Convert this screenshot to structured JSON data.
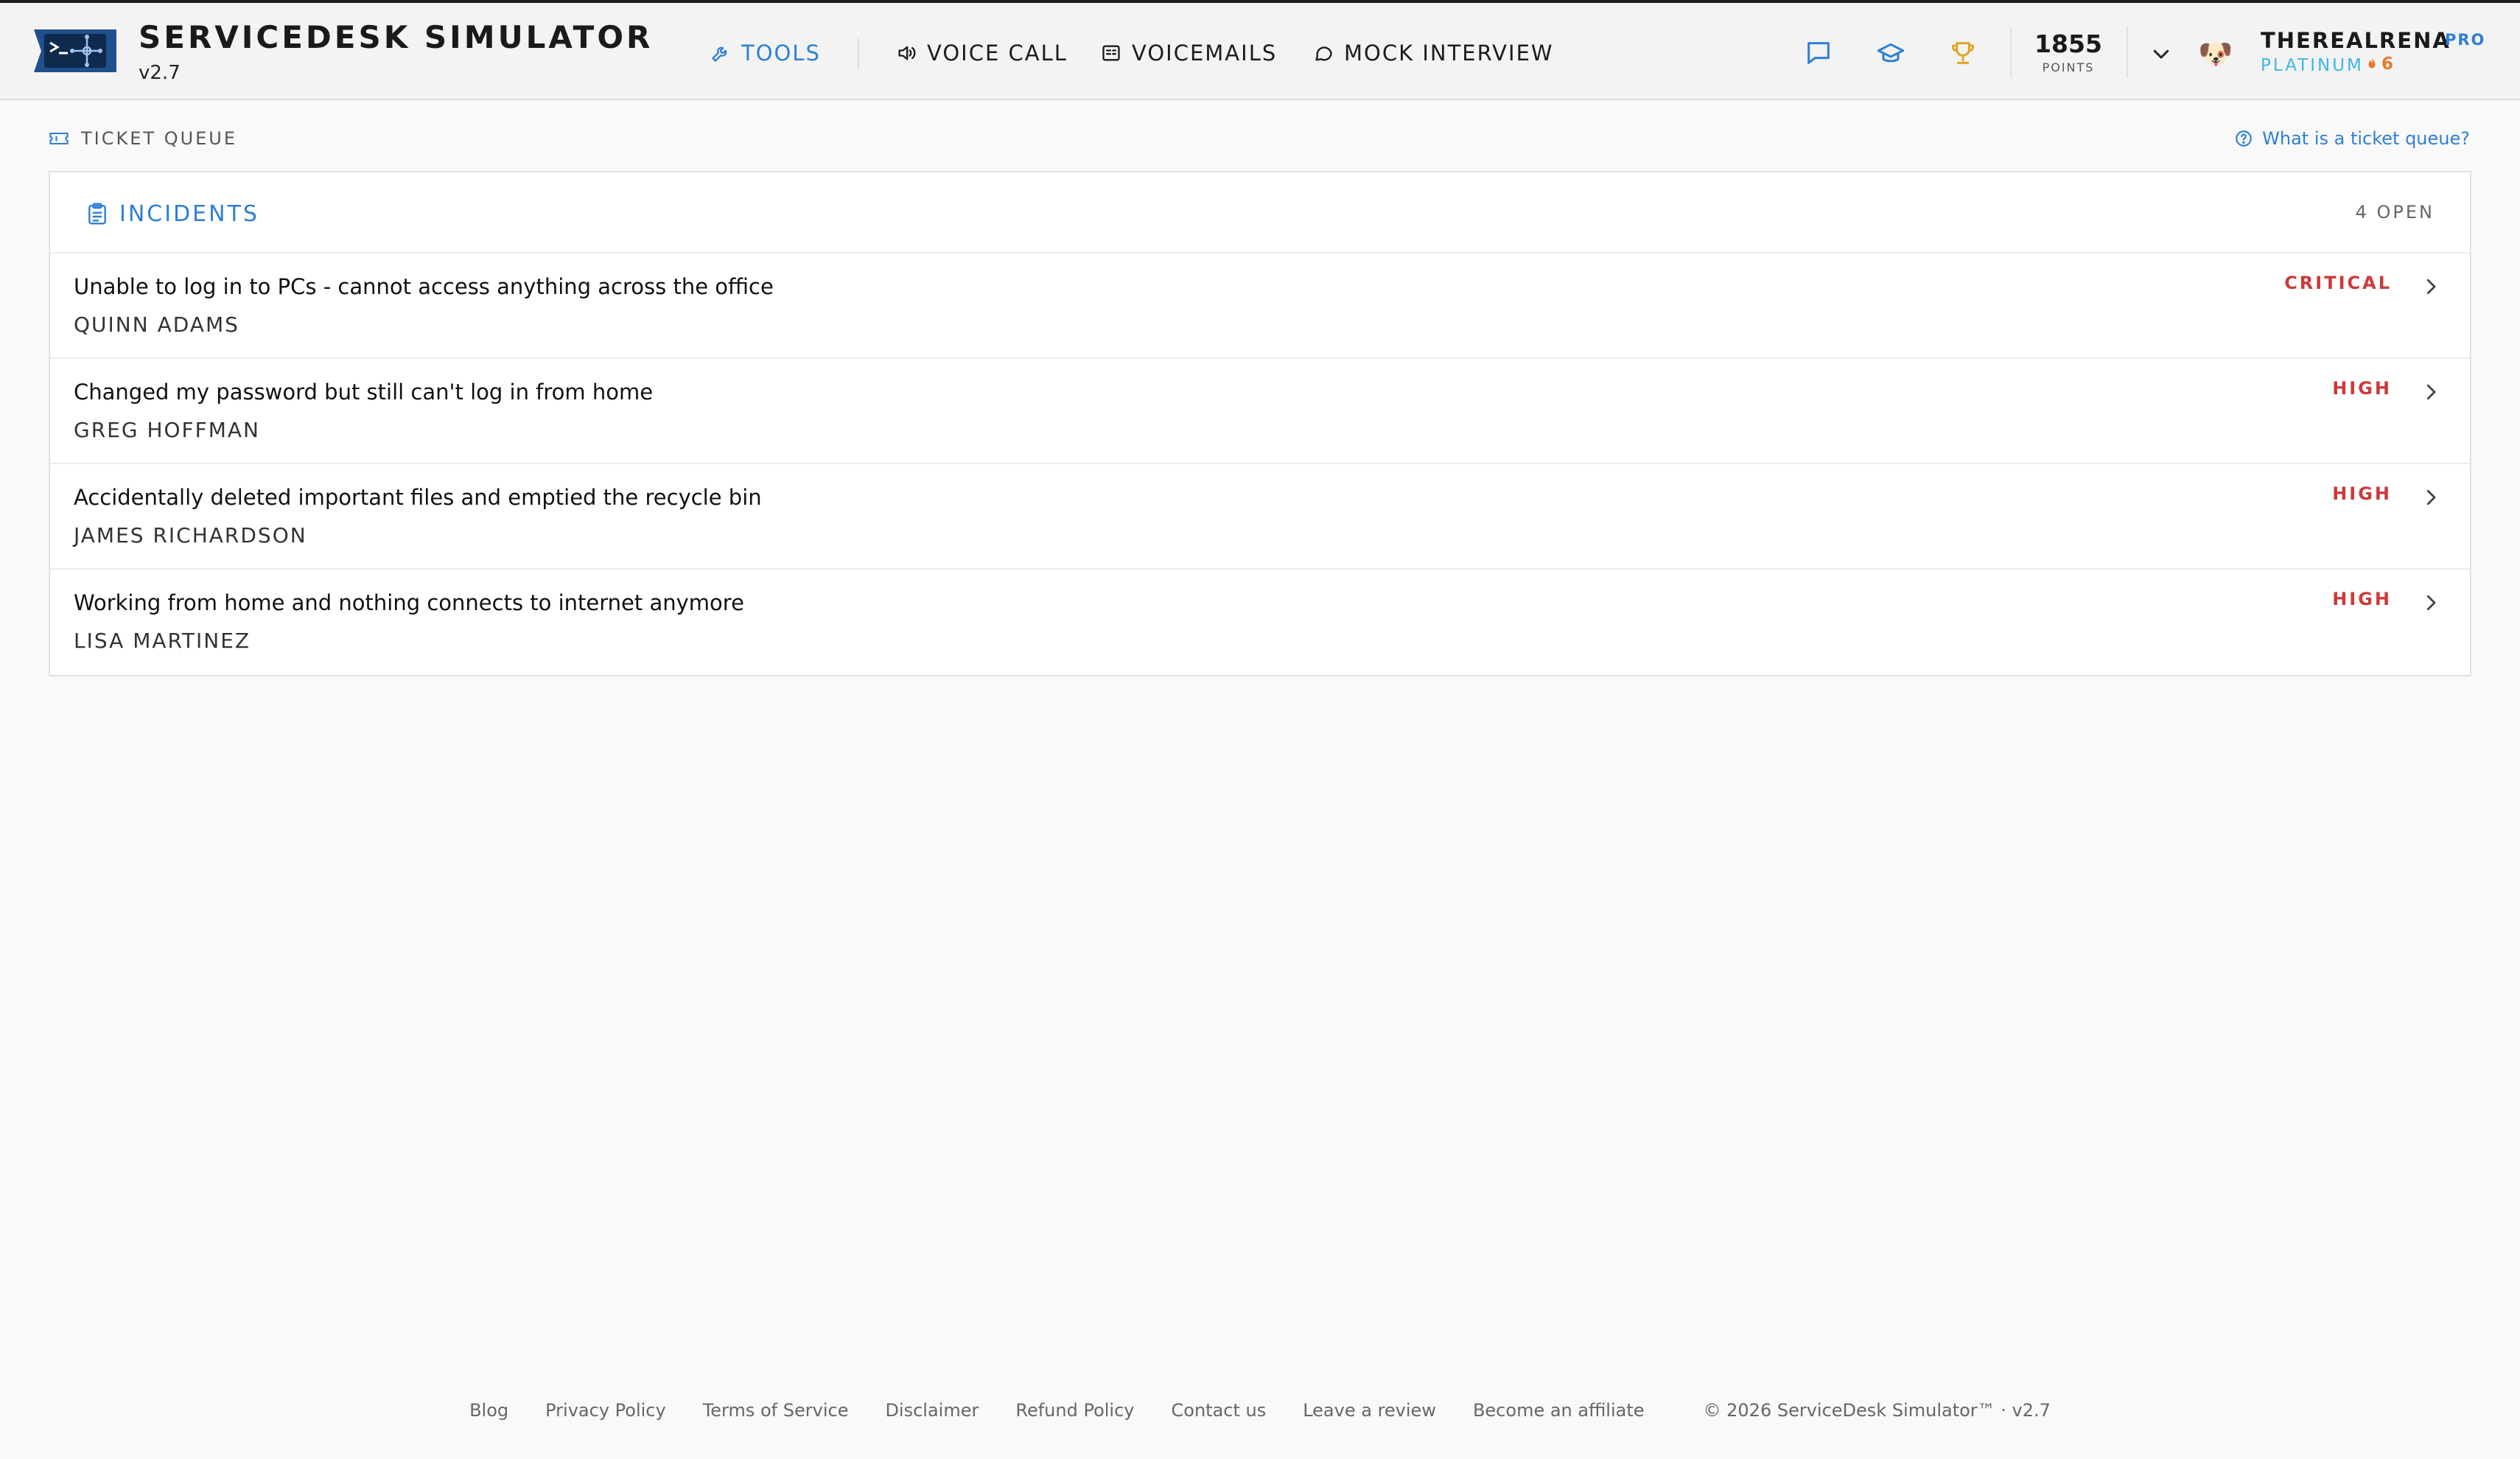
{
  "header": {
    "brand_title": "SERVICEDESK SIMULATOR",
    "version": "v2.7",
    "nav": [
      {
        "label": "TOOLS",
        "icon": "wrench-icon",
        "active": true
      },
      {
        "label": "VOICE CALL",
        "icon": "speaker-icon",
        "active": false
      },
      {
        "label": "VOICEMAILS",
        "icon": "voicemail-icon",
        "active": false
      },
      {
        "label": "MOCK INTERVIEW",
        "icon": "chat-bubble-icon",
        "active": false
      }
    ],
    "points": "1855",
    "points_label": "POINTS",
    "user": {
      "name": "THEREALRENA",
      "badge": "PRO",
      "tier": "PLATINUM",
      "streak": "6",
      "avatar": "🐶"
    }
  },
  "section": {
    "label": "TICKET QUEUE",
    "help_link": "What is a ticket queue?"
  },
  "panel": {
    "title": "INCIDENTS",
    "open_count": "4 OPEN",
    "tickets": [
      {
        "title": "Unable to log in to PCs - cannot access anything across the office",
        "reporter": "QUINN ADAMS",
        "priority": "CRITICAL"
      },
      {
        "title": "Changed my password but still can't log in from home",
        "reporter": "GREG HOFFMAN",
        "priority": "HIGH"
      },
      {
        "title": "Accidentally deleted important files and emptied the recycle bin",
        "reporter": "JAMES RICHARDSON",
        "priority": "HIGH"
      },
      {
        "title": "Working from home and nothing connects to internet anymore",
        "reporter": "LISA MARTINEZ",
        "priority": "HIGH"
      }
    ]
  },
  "footer": {
    "links": [
      "Blog",
      "Privacy Policy",
      "Terms of Service",
      "Disclaimer",
      "Refund Policy",
      "Contact us",
      "Leave a review",
      "Become an affiliate"
    ],
    "copyright": "© 2026 ServiceDesk Simulator™ · v2.7"
  },
  "colors": {
    "accent": "#2e7fd6",
    "priority": "#cc3a3a",
    "tier": "#3cb6e6",
    "streak": "#e8782a",
    "trophy": "#e0a526"
  }
}
